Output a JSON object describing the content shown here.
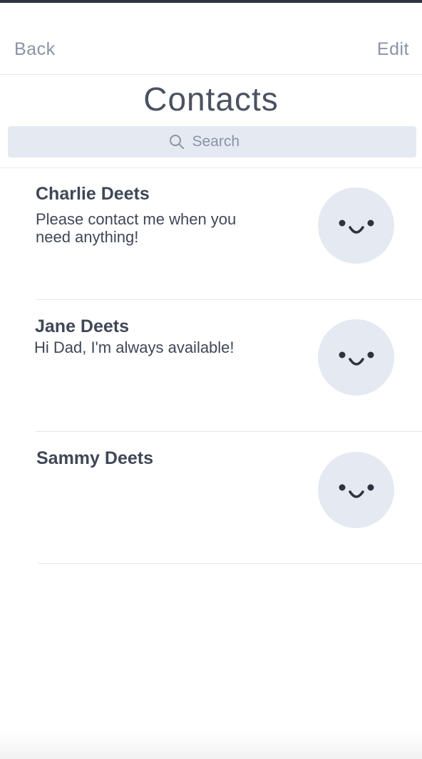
{
  "nav": {
    "back_label": "Back",
    "edit_label": "Edit"
  },
  "page": {
    "title": "Contacts"
  },
  "search": {
    "placeholder": "Search",
    "icon": "search-icon"
  },
  "contacts": [
    {
      "name": "Charlie Deets",
      "message": "Please contact me when you need anything!",
      "avatar_icon": "smiley-face-icon"
    },
    {
      "name": "Jane Deets",
      "message": "Hi Dad, I'm always available!",
      "avatar_icon": "smiley-face-icon"
    },
    {
      "name": "Sammy Deets",
      "message": "",
      "avatar_icon": "smiley-face-icon"
    }
  ],
  "colors": {
    "accent_text": "#8a94a6",
    "avatar_bg": "#e4e9f2",
    "primary_text": "#3f4757"
  }
}
